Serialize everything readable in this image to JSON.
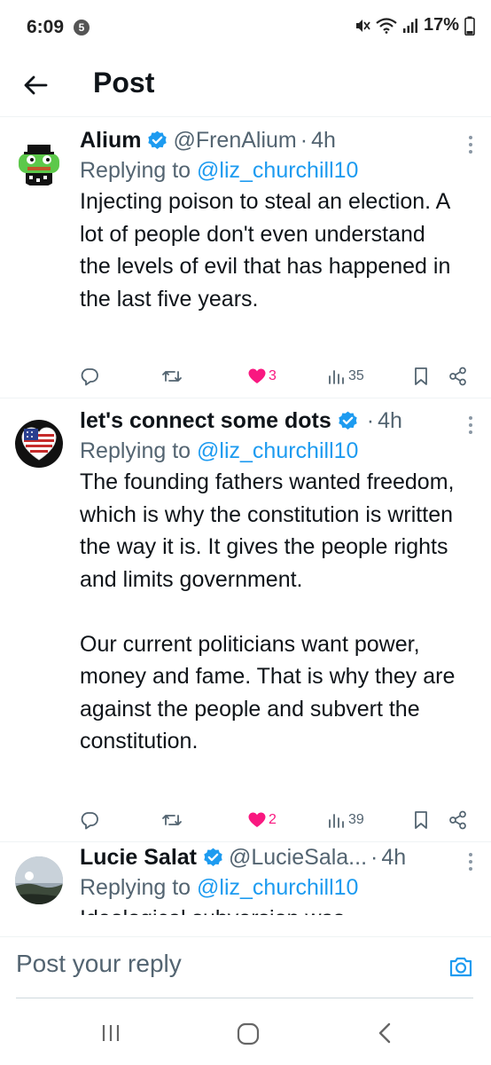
{
  "status_bar": {
    "time": "6:09",
    "notification_count": "5",
    "battery": "17%",
    "icons": [
      "mute-icon",
      "wifi-icon",
      "signal-icon",
      "battery-icon"
    ]
  },
  "header": {
    "title": "Post",
    "back_icon": "arrow-left-icon"
  },
  "posts": [
    {
      "author": "Alium",
      "handle": "@FrenAlium",
      "time": "4h",
      "verified": true,
      "replying_prefix": "Replying to ",
      "replying_to": "@liz_churchill10",
      "text": "Injecting poison to steal an election. A lot of people don't even understand the levels of evil that has happened in the last five years.",
      "likes": "3",
      "views": "35",
      "liked": true,
      "avatar_icon": "pepe-frog-avatar"
    },
    {
      "author": "let's connect some dots",
      "handle": "",
      "time": "4h",
      "verified": true,
      "replying_prefix": "Replying to ",
      "replying_to": "@liz_churchill10",
      "text": "The founding fathers wanted freedom, which is why the constitution is written the way it is. It gives the people rights and limits government.\n\nOur current politicians want power, money and fame. That is why they are against the people and subvert the constitution.",
      "likes": "2",
      "views": "39",
      "liked": true,
      "avatar_icon": "flag-heart-avatar"
    },
    {
      "author": "Lucie Salat",
      "handle": "@LucieSala...",
      "time": "4h",
      "verified": true,
      "replying_prefix": "Replying to ",
      "replying_to": "@liz_churchill10",
      "text": "Ideological subversion was",
      "avatar_icon": "landscape-avatar"
    }
  ],
  "dot": "·",
  "reply_bar": {
    "placeholder": "Post your reply",
    "camera_icon": "camera-icon"
  },
  "nav_bar": {
    "buttons": [
      "recent-apps-icon",
      "home-icon",
      "back-icon"
    ]
  },
  "colors": {
    "accent": "#1d9bf0",
    "like": "#f91880",
    "secondary_text": "#536471"
  }
}
